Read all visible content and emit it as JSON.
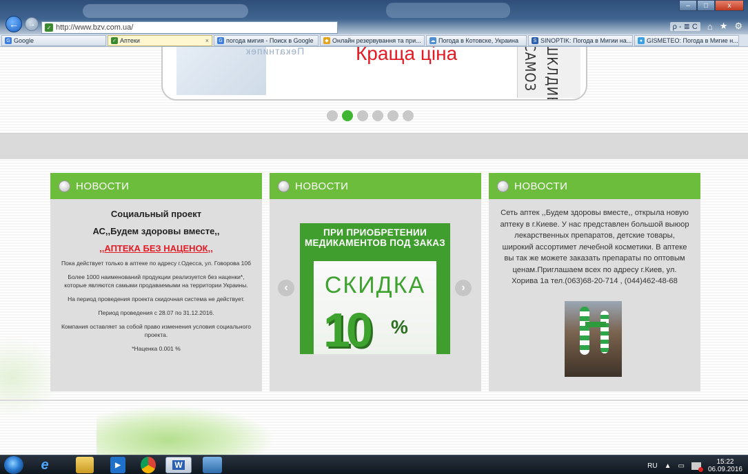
{
  "browser": {
    "url": "http://www.bzv.com.ua/",
    "tabs": [
      {
        "label": "Google",
        "icon": "google-icon",
        "active": false
      },
      {
        "label": "Аптеки",
        "icon": "site-icon",
        "active": true
      },
      {
        "label": "погода мигия - Поиск в Google",
        "icon": "google-icon",
        "active": false
      },
      {
        "label": "Онлайн резервування та при...",
        "icon": "shield-icon",
        "active": false
      },
      {
        "label": "Погода в Котовске, Украина",
        "icon": "weather-icon",
        "active": false
      },
      {
        "label": "SINOPTIK: Погода в Мигии на...",
        "icon": "sinoptik-icon",
        "active": false
      },
      {
        "label": "GISMETEO: Погода в Мигие н...",
        "icon": "gismeteo-icon",
        "active": false
      }
    ],
    "tab_close": "×",
    "search_glyph": "ρ - ≣ C"
  },
  "slider": {
    "headline": "Краща ціна",
    "left_text": "Пекатнипек",
    "vertical_1": "САМОЗ",
    "vertical_2": "ШКЛДИВЫ",
    "dot_count": 6,
    "active_dot": 2
  },
  "cards": [
    {
      "heading": "НОВОСТИ",
      "title": "Социальный проект",
      "subtitle": "АС,,Будем здоровы вместе,,",
      "link": ",,АПТЕКА БЕЗ НАЦЕНОК,,",
      "paragraphs": [
        "Пока действует только в аптеке по адресу г.Одесса, ул. Говорова 10б",
        "Более 1000 наименований продукции реализуется без наценки*, которые являются самыми продаваемыми на территории Украины.",
        "На период проведения проекта скидочная система не действует.",
        "Период проведения с 28.07 по 31.12.2016.",
        "Компания оставляет за собой право изменения условия социального проекта.",
        "*Наценка 0.001 %"
      ]
    },
    {
      "heading": "НОВОСТИ",
      "promo_top": "ПРИ ПРИОБРЕТЕНИИ МЕДИКАМЕНТОВ ПОД ЗАКАЗ",
      "promo_word": "СКИДКА",
      "promo_number": "10",
      "promo_percent": "%",
      "prev": "‹",
      "next": "›"
    },
    {
      "heading": "НОВОСТИ",
      "text": "Сеть аптек ,,Будем здоровы вместе,, открыла новую аптеку в г.Киеве. У нас представлен большой выюор лекарственных препаратов, детские товары, широкий ассортимет лечебной косметики. В аптеке вы так же можете заказать препараты по оптовым ценам.Приглашаем всех по адресу г.Киев, ул. Хорива 1а тел.(063)68-20-714 , (044)462-48-68"
    }
  ],
  "taskbar": {
    "lang": "RU",
    "time": "15:22",
    "date": "06.09.2016",
    "word_label": "W"
  },
  "colors": {
    "accent_green": "#6cbd3b",
    "promo_red": "#e21b24",
    "dot_active": "#3fb531"
  }
}
